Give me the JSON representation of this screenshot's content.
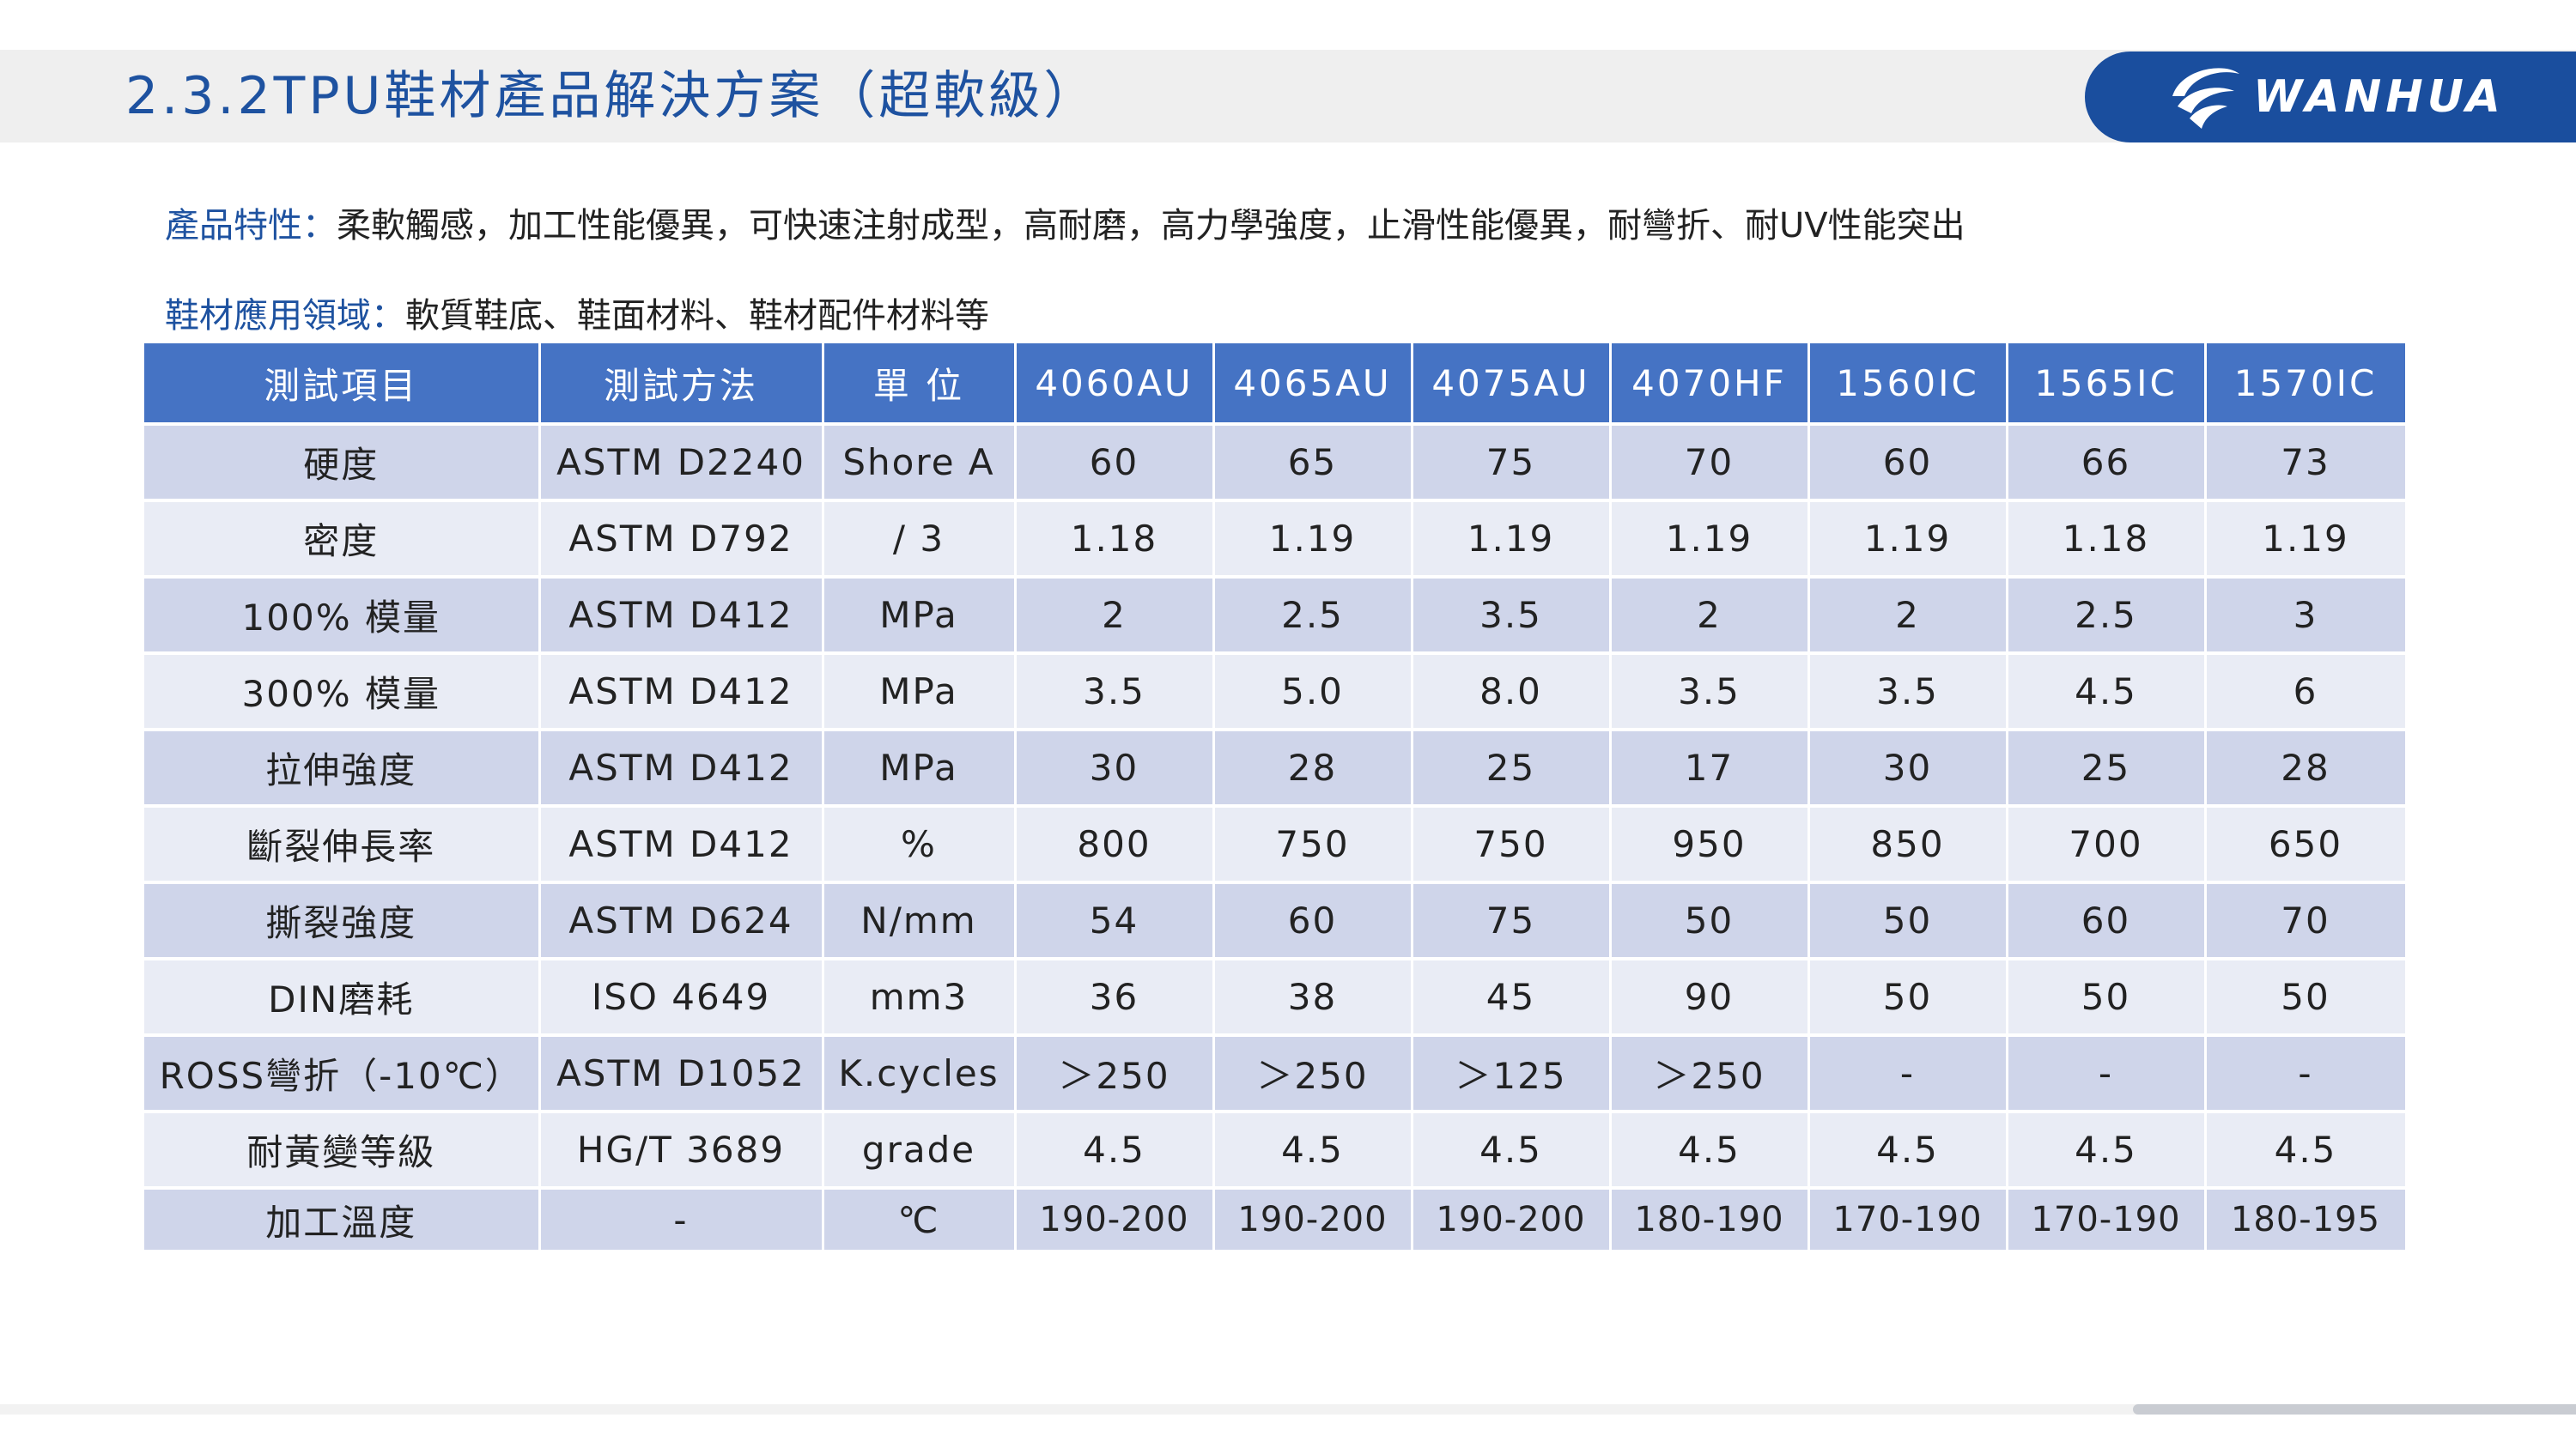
{
  "header": {
    "title": "2.3.2TPU鞋材產品解決方案（超軟級）",
    "logo_text": "WANHUA"
  },
  "description": {
    "features_label": "產品特性：",
    "features_text": "柔軟觸感，加工性能優異，可快速注射成型，高耐磨，高力學強度，止滑性能優異，耐彎折、耐UV性能突出",
    "applications_label": "鞋材應用領域：",
    "applications_text": "軟質鞋底、鞋面材料、鞋材配件材料等"
  },
  "table": {
    "headers": [
      "測試項目",
      "測試方法",
      "單 位",
      "4060AU",
      "4065AU",
      "4075AU",
      "4070HF",
      "1560IC",
      "1565IC",
      "1570IC"
    ],
    "rows": [
      [
        "硬度",
        "ASTM D2240",
        "Shore A",
        "60",
        "65",
        "75",
        "70",
        "60",
        "66",
        "73"
      ],
      [
        "密度",
        "ASTM D792",
        "/  3",
        "1.18",
        "1.19",
        "1.19",
        "1.19",
        "1.19",
        "1.18",
        "1.19"
      ],
      [
        "100% 模量",
        "ASTM D412",
        "MPa",
        "2",
        "2.5",
        "3.5",
        "2",
        "2",
        "2.5",
        "3"
      ],
      [
        "300% 模量",
        "ASTM D412",
        "MPa",
        "3.5",
        "5.0",
        "8.0",
        "3.5",
        "3.5",
        "4.5",
        "6"
      ],
      [
        "拉伸強度",
        "ASTM D412",
        "MPa",
        "30",
        "28",
        "25",
        "17",
        "30",
        "25",
        "28"
      ],
      [
        "斷裂伸長率",
        "ASTM D412",
        "%",
        "800",
        "750",
        "750",
        "950",
        "850",
        "700",
        "650"
      ],
      [
        "撕裂強度",
        "ASTM D624",
        "N/mm",
        "54",
        "60",
        "75",
        "50",
        "50",
        "60",
        "70"
      ],
      [
        "DIN磨耗",
        "ISO 4649",
        "mm3",
        "36",
        "38",
        "45",
        "90",
        "50",
        "50",
        "50"
      ],
      [
        "ROSS彎折（-10℃）",
        "ASTM D1052",
        "K.cycles",
        "＞250",
        "＞250",
        "＞125",
        "＞250",
        "-",
        "-",
        "-"
      ],
      [
        "耐黃變等級",
        "HG/T 3689",
        "grade",
        "4.5",
        "4.5",
        "4.5",
        "4.5",
        "4.5",
        "4.5",
        "4.5"
      ],
      [
        "加工溫度",
        "-",
        "℃",
        "190-200",
        "190-200",
        "190-200",
        "180-190",
        "170-190",
        "170-190",
        "180-195"
      ]
    ]
  },
  "colors": {
    "title_blue": "#1e52a0",
    "header_blue": "#4573c4",
    "row_dark": "#cfd5ea",
    "row_light": "#e9ecf5",
    "logo_bg": "#1a4e9e"
  }
}
